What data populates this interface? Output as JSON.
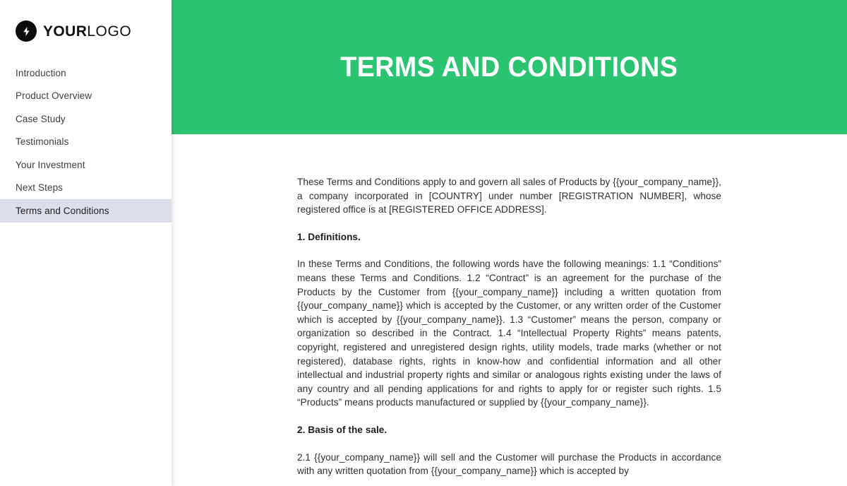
{
  "sidebar": {
    "logo": {
      "icon": "lightning-bolt-icon",
      "text_bold": "YOUR",
      "text_light": "LOGO"
    },
    "items": [
      {
        "label": "Introduction",
        "active": false
      },
      {
        "label": "Product Overview",
        "active": false
      },
      {
        "label": "Case Study",
        "active": false
      },
      {
        "label": "Testimonials",
        "active": false
      },
      {
        "label": "Your Investment",
        "active": false
      },
      {
        "label": "Next Steps",
        "active": false
      },
      {
        "label": "Terms and Conditions",
        "active": true
      }
    ]
  },
  "hero": {
    "title": "TERMS AND CONDITIONS",
    "background_color": "#2bc571",
    "text_color": "#ffffff"
  },
  "document": {
    "intro_paragraph": "These Terms and Conditions apply to and govern all sales of Products by {{your_company_name}}, a company incorporated in [COUNTRY] under number [REGISTRATION NUMBER], whose registered office is at [REGISTERED OFFICE ADDRESS].",
    "section_1_heading": "1. Definitions.",
    "section_1_body": "In these Terms and Conditions, the following words have the following meanings: 1.1 “Conditions” means these Terms and Conditions. 1.2 “Contract” is an agreement for the purchase of the Products by the Customer from {{your_company_name}} including a written quotation from {{your_company_name}} which is accepted by the Customer, or any written order of the Customer which is accepted by {{your_company_name}}. 1.3 “Customer” means the person, company or organization so described in the Contract. 1.4 “Intellectual Property Rights” means patents, copyright, registered and unregistered design rights, utility models, trade marks (whether or not registered), database rights, rights in know-how and confidential information and all other intellectual and industrial property rights and similar or analogous rights existing under the laws of any country and all pending applications for and rights to apply for or register such rights. 1.5 “Products” means products manufactured or supplied by {{your_company_name}}.",
    "section_2_heading": "2. Basis of the sale.",
    "section_2_body": "2.1 {{your_company_name}} will sell and the Customer will purchase the Products in accordance with any written quotation from {{your_company_name}} which is accepted by"
  }
}
